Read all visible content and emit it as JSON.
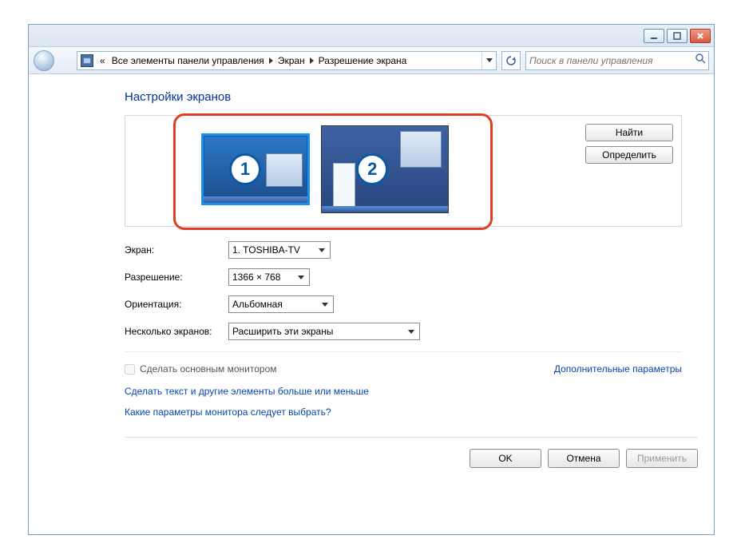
{
  "breadcrumb": {
    "prefix": "«",
    "items": [
      "Все элементы панели управления",
      "Экран",
      "Разрешение экрана"
    ]
  },
  "search": {
    "placeholder": "Поиск в панели управления"
  },
  "page": {
    "title": "Настройки экранов"
  },
  "displays": [
    {
      "number": "1",
      "primary": true
    },
    {
      "number": "2",
      "primary": false
    }
  ],
  "panel_buttons": {
    "find": "Найти",
    "identify": "Определить"
  },
  "form": {
    "screen": {
      "label": "Экран:",
      "value": "1. TOSHIBA-TV"
    },
    "resolution": {
      "label": "Разрешение:",
      "value": "1366 × 768"
    },
    "orientation": {
      "label": "Ориентация:",
      "value": "Альбомная"
    },
    "multi": {
      "label": "Несколько экранов:",
      "value": "Расширить эти экраны"
    }
  },
  "checkbox": {
    "label": "Сделать основным монитором"
  },
  "links": {
    "advanced": "Дополнительные параметры",
    "text_size": "Сделать текст и другие элементы больше или меньше",
    "help": "Какие параметры монитора следует выбрать?"
  },
  "buttons": {
    "ok": "OK",
    "cancel": "Отмена",
    "apply": "Применить"
  }
}
